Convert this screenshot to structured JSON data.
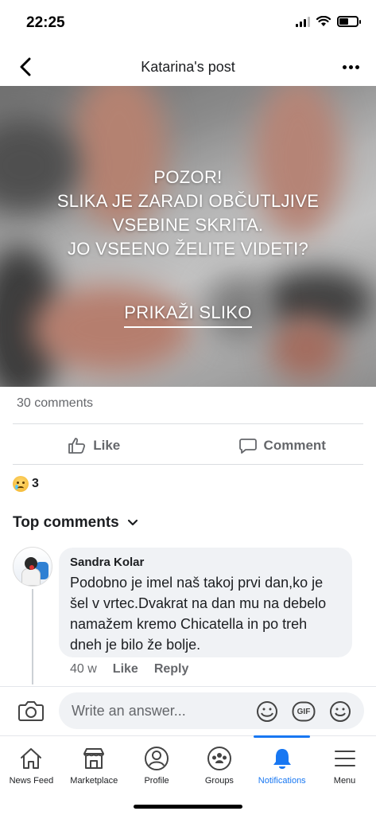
{
  "status_bar": {
    "time": "22:25"
  },
  "header": {
    "title": "Katarina's post"
  },
  "post": {
    "warning_lines": [
      "POZOR!",
      "SLIKA JE ZARADI OBČUTLJIVE",
      "VSEBINE SKRITA.",
      "JO VSEENO ŽELITE VIDETI?"
    ],
    "show_button": "PRIKAŽI SLIKO",
    "comments_count": "30 comments",
    "like_label": "Like",
    "comment_label": "Comment",
    "reaction_count": "3"
  },
  "comments": {
    "section_title": "Top comments",
    "items": [
      {
        "author": "Sandra Kolar",
        "text": "Podobno je imel naš takoj prvi dan,ko je šel v vrtec.Dvakrat na dan mu na debelo namažem kremo Chicatella in po treh dneh je bilo že bolje.",
        "time": "40 w",
        "like": "Like",
        "reply": "Reply"
      }
    ]
  },
  "composer": {
    "placeholder": "Write an answer...",
    "gif_label": "GIF"
  },
  "tabs": [
    {
      "label": "News Feed",
      "icon": "home-icon"
    },
    {
      "label": "Marketplace",
      "icon": "marketplace-icon"
    },
    {
      "label": "Profile",
      "icon": "profile-icon"
    },
    {
      "label": "Groups",
      "icon": "groups-icon"
    },
    {
      "label": "Notifications",
      "icon": "bell-icon",
      "active": true
    },
    {
      "label": "Menu",
      "icon": "menu-icon"
    }
  ],
  "colors": {
    "accent": "#1877f2",
    "secondary_text": "#65676b",
    "bubble": "#f0f2f5"
  }
}
